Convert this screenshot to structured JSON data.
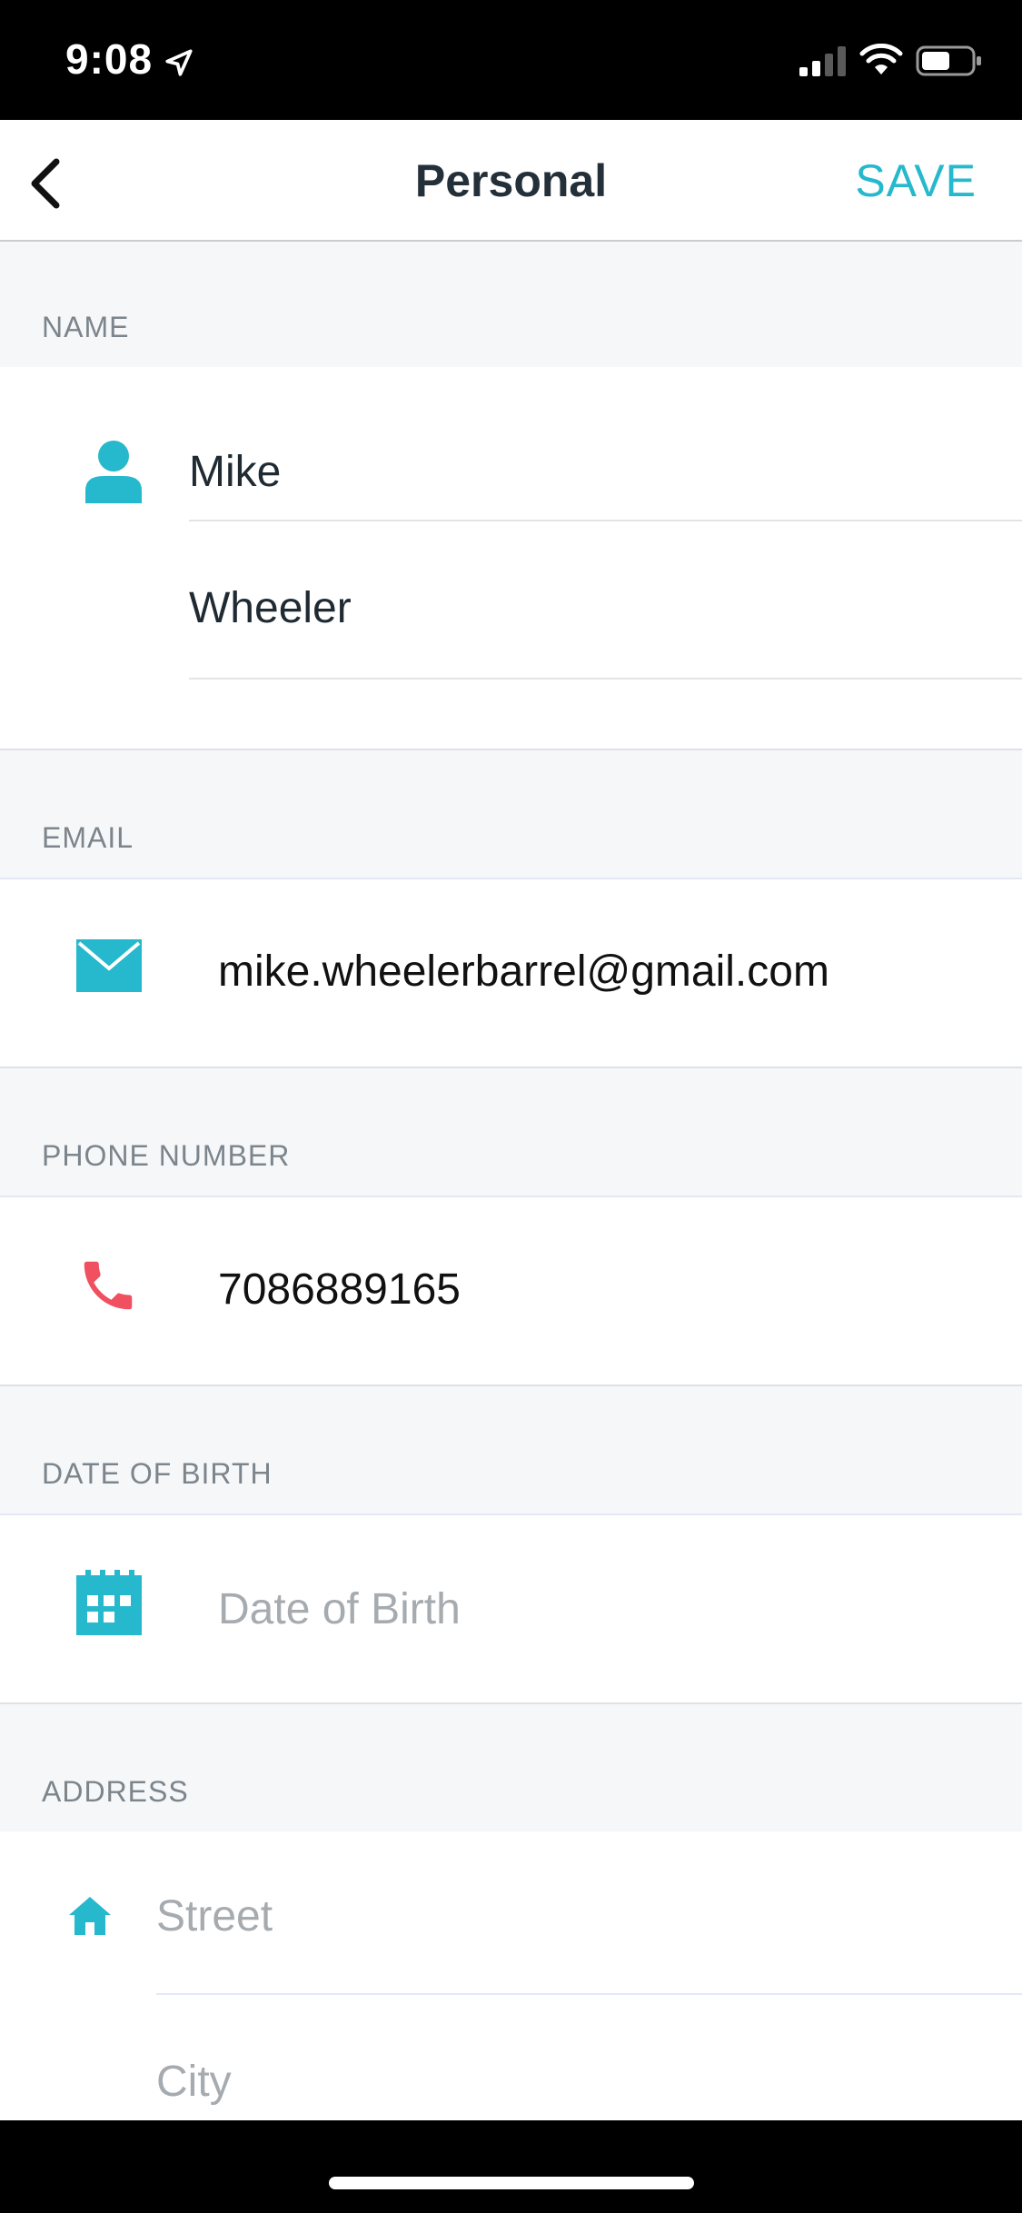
{
  "status_bar": {
    "time": "9:08"
  },
  "nav": {
    "title": "Personal",
    "save_label": "SAVE"
  },
  "sections": {
    "name": {
      "label": "NAME",
      "first_name": "Mike",
      "last_name": "Wheeler"
    },
    "email": {
      "label": "EMAIL",
      "value": "mike.wheelerbarrel@gmail.com"
    },
    "phone": {
      "label": "PHONE NUMBER",
      "value": "7086889165"
    },
    "dob": {
      "label": "DATE OF BIRTH",
      "placeholder": "Date of Birth"
    },
    "address": {
      "label": "ADDRESS",
      "street_placeholder": "Street",
      "city_placeholder": "City"
    }
  },
  "colors": {
    "accent": "#26b8cc",
    "phone_icon": "#f0505f",
    "background": "#f6f7f9"
  },
  "icons": [
    "location-arrow-icon",
    "cellular-signal-icon",
    "wifi-icon",
    "battery-icon",
    "back-chevron-icon",
    "person-icon",
    "mail-icon",
    "phone-icon",
    "calendar-icon",
    "home-icon"
  ]
}
